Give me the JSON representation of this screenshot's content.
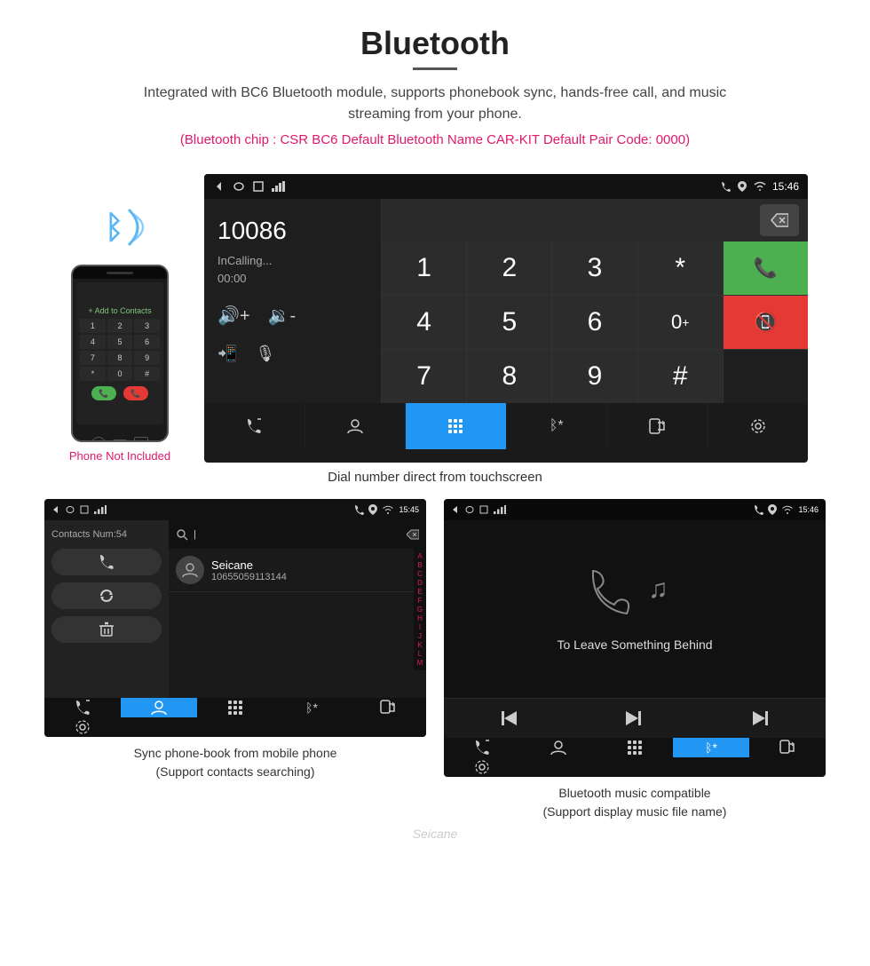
{
  "header": {
    "title": "Bluetooth",
    "subtitle": "Integrated with BC6 Bluetooth module, supports phonebook sync, hands-free call, and music streaming from your phone.",
    "chip_info": "(Bluetooth chip : CSR BC6     Default Bluetooth Name CAR-KIT     Default Pair Code: 0000)"
  },
  "dial_screen": {
    "statusbar": {
      "time": "15:46"
    },
    "number": "10086",
    "calling": "InCalling...",
    "timer": "00:00",
    "keypad": [
      "1",
      "2",
      "3",
      "*",
      "",
      "4",
      "5",
      "6",
      "0+",
      "",
      "7",
      "8",
      "9",
      "#",
      ""
    ],
    "caption": "Dial number direct from touchscreen"
  },
  "phone_mockup": {
    "label": "Phone Not Included"
  },
  "contacts_screen": {
    "statusbar_time": "15:45",
    "contacts_count": "Contacts Num:54",
    "contact": {
      "name": "Seicane",
      "phone": "10655059113144"
    },
    "search_placeholder": "Search",
    "alphabet": [
      "A",
      "B",
      "C",
      "D",
      "E",
      "F",
      "G",
      "H",
      "I",
      "J",
      "K",
      "L",
      "M"
    ],
    "caption_line1": "Sync phone-book from mobile phone",
    "caption_line2": "(Support contacts searching)"
  },
  "music_screen": {
    "statusbar_time": "15:46",
    "song_title": "To Leave Something Behind",
    "caption_line1": "Bluetooth music compatible",
    "caption_line2": "(Support display music file name)"
  },
  "watermark": "Seicane"
}
